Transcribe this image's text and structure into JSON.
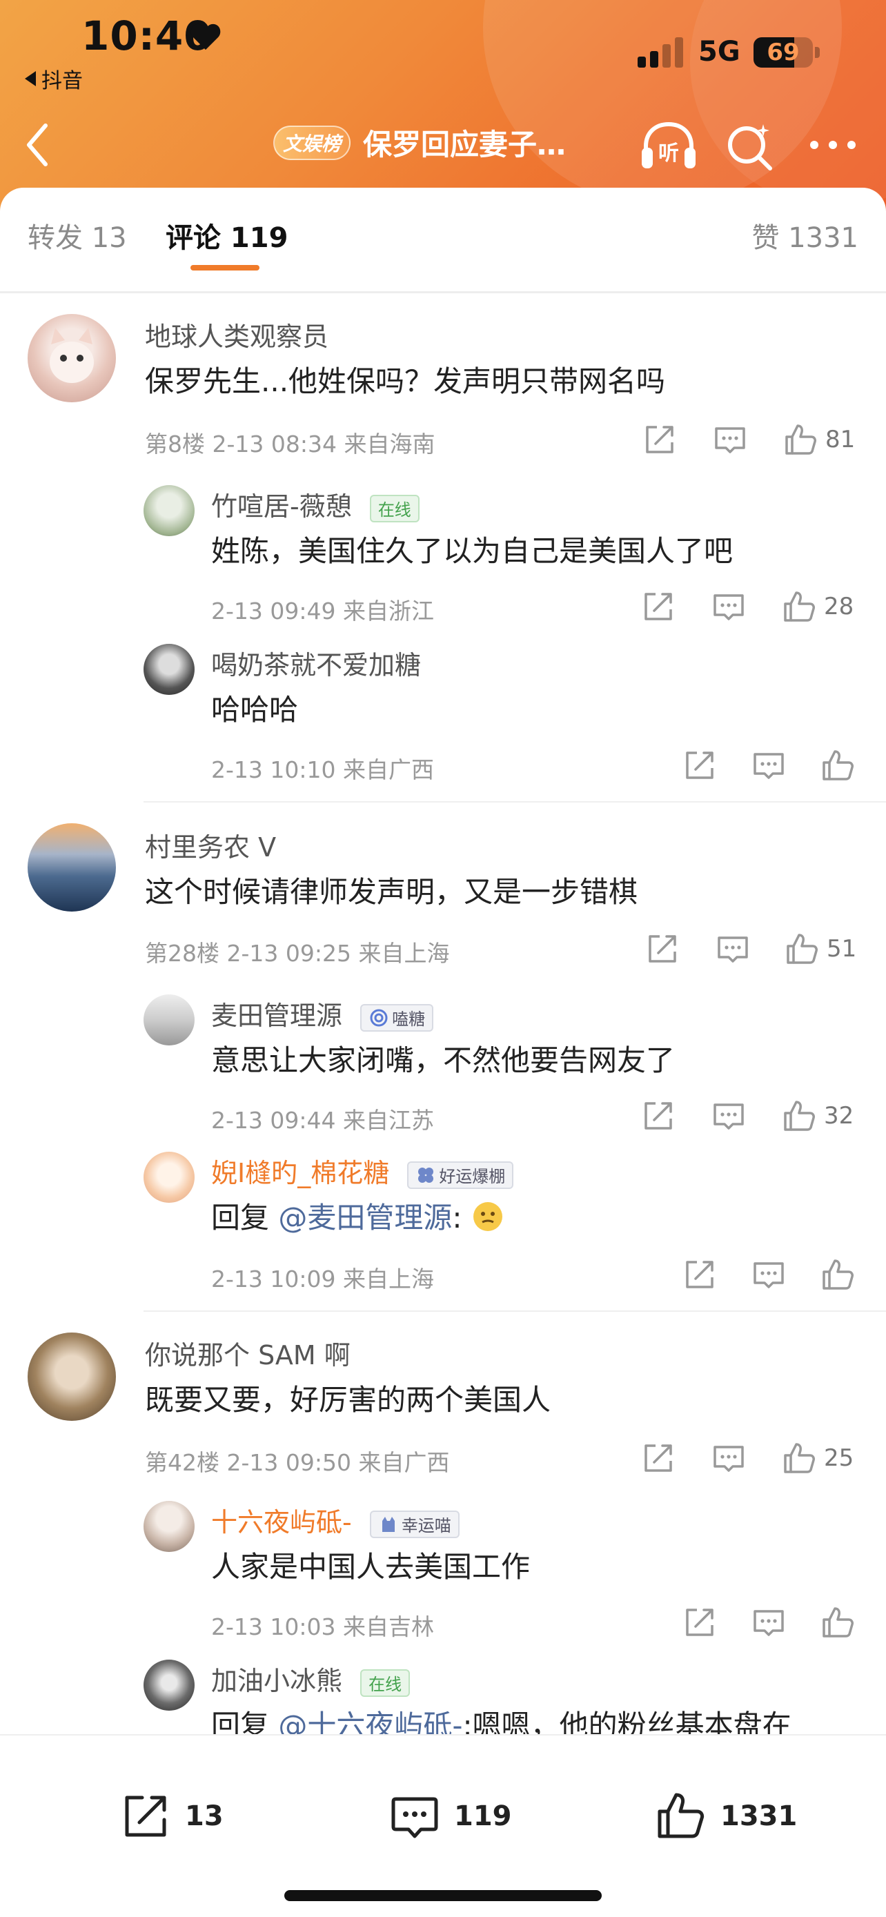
{
  "status_bar": {
    "time": "10:40",
    "back_app_label": "抖音",
    "network": "5G",
    "battery": "69",
    "battery_level": 0.69
  },
  "nav": {
    "topic_badge": "文娱榜",
    "title": "保罗回应妻子…"
  },
  "tabs": {
    "repost": "转发 13",
    "comments": "评论 119",
    "likes": "赞 1331"
  },
  "colors": {
    "accent": "#f07b2a",
    "header_gradient_start": "#f2a446",
    "header_gradient_end": "#ec5d28",
    "mention": "#4e6a9b"
  },
  "comments": [
    {
      "name": "地球人类观察员",
      "text": "保罗先生...他姓保吗？发声明只带网名吗",
      "meta": "第8楼 2-13 08:34 来自海南",
      "likes": "81",
      "replies": [
        {
          "name": "竹喧居-薇憩",
          "badge": "在线",
          "text": "姓陈，美国住久了以为自己是美国人了吧",
          "meta": "2-13 09:49 来自浙江",
          "likes": "28"
        },
        {
          "name": "喝奶茶就不爱加糖",
          "text": "哈哈哈",
          "meta": "2-13 10:10 来自广西",
          "likes": ""
        }
      ]
    },
    {
      "name": "村里务农 V",
      "text": "这个时候请律师发声明，又是一步错棋",
      "meta": "第28楼 2-13 09:25 来自上海",
      "likes": "51",
      "replies": [
        {
          "name": "麦田管理源",
          "badge": "嗑糖",
          "text": "意思让大家闭嘴，不然他要告网友了",
          "meta": "2-13 09:44 来自江苏",
          "likes": "32"
        },
        {
          "name": "婗Ι槰旳_棉花糖",
          "badge": "好运爆棚",
          "text_prefix": "回复 ",
          "mention": "@麦田管理源",
          "text_suffix": ":",
          "meta": "2-13 10:09 来自上海",
          "likes": ""
        }
      ]
    },
    {
      "name": "你说那个 SAM 啊",
      "text": "既要又要，好厉害的两个美国人",
      "meta": "第42楼 2-13 09:50 来自广西",
      "likes": "25",
      "replies": [
        {
          "name": "十六夜屿砥-",
          "badge": "幸运喵",
          "text": "人家是中国人去美国工作",
          "meta": "2-13 10:03 来自吉林",
          "likes": ""
        },
        {
          "name": "加油小冰熊",
          "badge": "在线",
          "text_prefix": "回复 ",
          "mention": "@十六夜屿砥-",
          "text_suffix": ":嗯嗯，他的粉丝基本盘在"
        }
      ]
    }
  ],
  "bottom_bar": {
    "reposts": "13",
    "comments": "119",
    "likes": "1331"
  },
  "icons": [
    "heart-icon",
    "signal-icon",
    "battery-icon",
    "back-icon",
    "listen-icon",
    "search-icon",
    "more-icon",
    "share-icon",
    "comment-icon",
    "like-icon",
    "clover-icon",
    "lollipop-icon",
    "cat-icon",
    "emoji-icon"
  ]
}
